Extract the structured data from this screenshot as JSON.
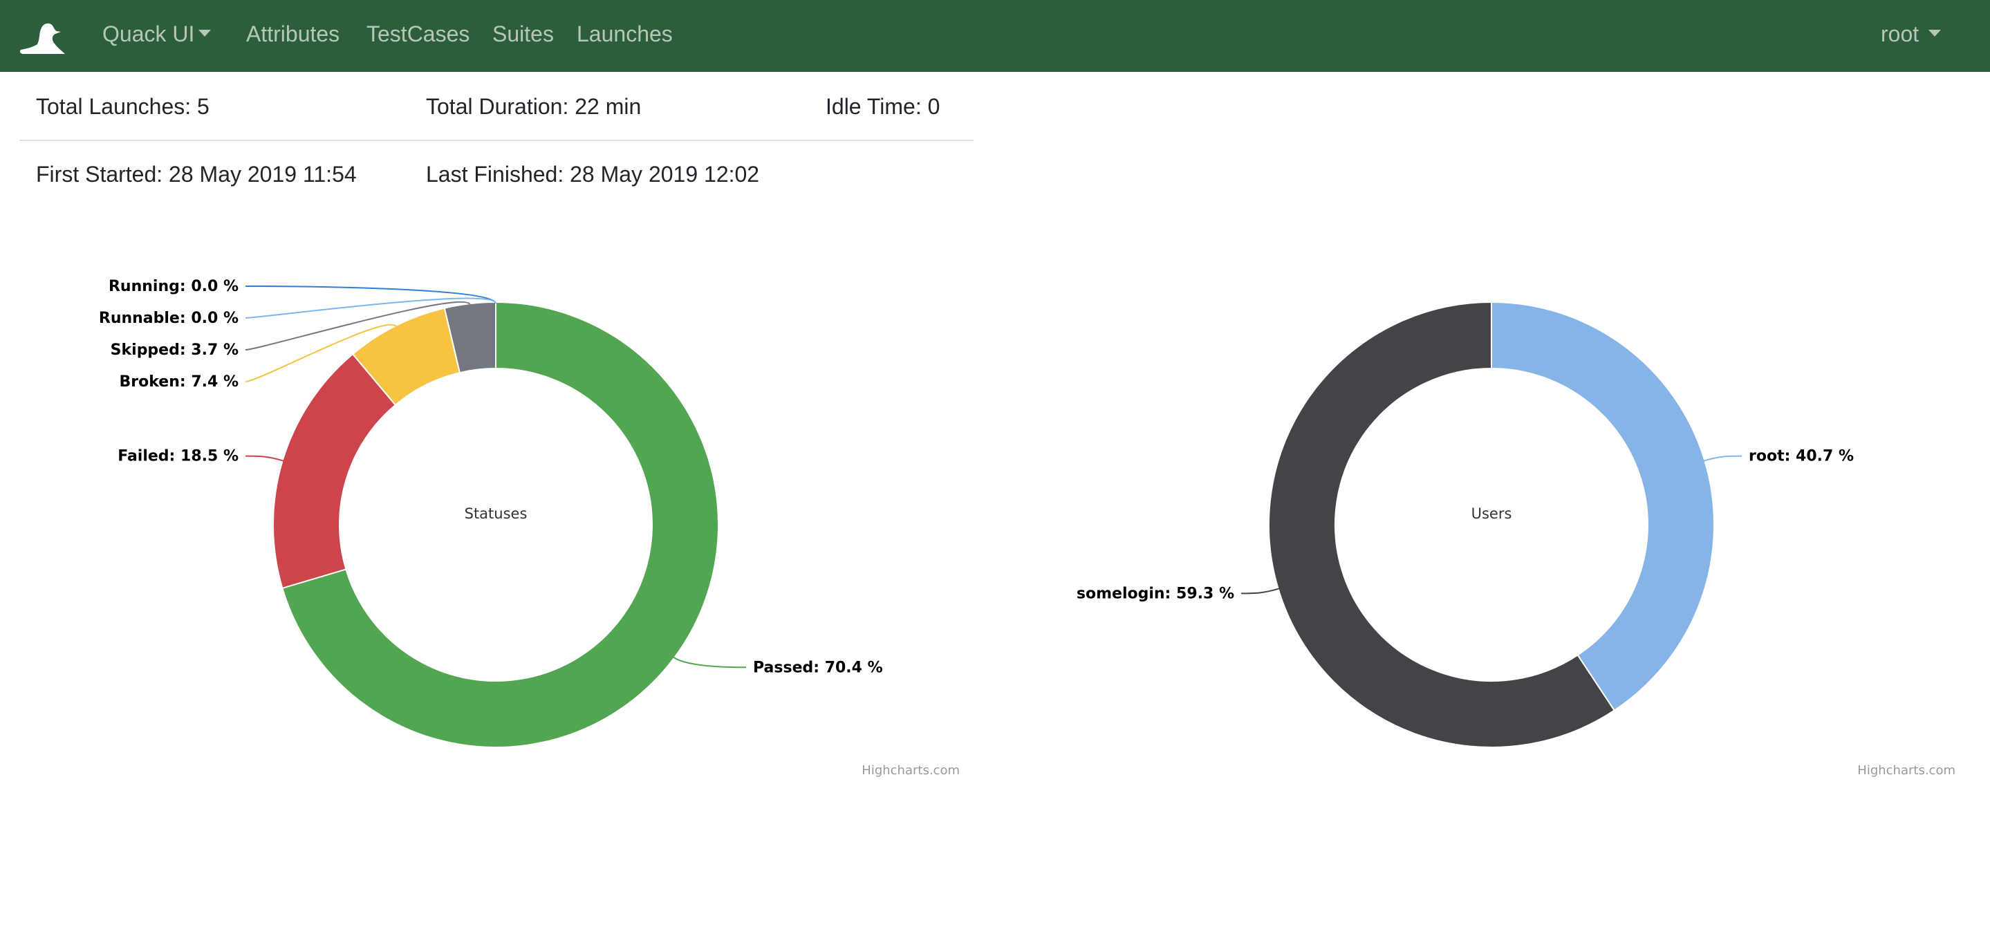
{
  "navbar": {
    "logo_icon": "duck-icon",
    "brand_label": "Quack UI",
    "items": [
      {
        "label": "Attributes"
      },
      {
        "label": "TestCases"
      },
      {
        "label": "Suites"
      },
      {
        "label": "Launches"
      }
    ],
    "user_label": "root",
    "bg_color": "#2c5e3b"
  },
  "stats": {
    "total_launches": "Total Launches: 5",
    "total_duration": "Total Duration: 22 min",
    "idle_time": "Idle Time: 0",
    "first_started": "First Started: 28 May 2019 11:54",
    "last_finished": "Last Finished: 28 May 2019 12:02"
  },
  "chart_data": [
    {
      "type": "pie",
      "title": "Statuses",
      "credits": "Highcharts.com",
      "series": [
        {
          "name": "Passed",
          "value": 70.4,
          "label": "Passed: 70.4 %",
          "color": "#52a551"
        },
        {
          "name": "Failed",
          "value": 18.5,
          "label": "Failed: 18.5 %",
          "color": "#ce444b"
        },
        {
          "name": "Broken",
          "value": 7.4,
          "label": "Broken: 7.4 %",
          "color": "#f6c343"
        },
        {
          "name": "Skipped",
          "value": 3.7,
          "label": "Skipped: 3.7 %",
          "color": "#737880"
        },
        {
          "name": "Running",
          "value": 0.0,
          "label": "Running: 0.0 %",
          "color": "#2f7ed8"
        },
        {
          "name": "Runnable",
          "value": 0.0,
          "label": "Runnable: 0.0 %",
          "color": "#7cb5ec"
        }
      ]
    },
    {
      "type": "pie",
      "title": "Users",
      "credits": "Highcharts.com",
      "series": [
        {
          "name": "root",
          "value": 40.7,
          "label": "root: 40.7 %",
          "color": "#87b4e7"
        },
        {
          "name": "somelogin",
          "value": 59.3,
          "label": "somelogin: 59.3 %",
          "color": "#434348"
        }
      ]
    }
  ]
}
